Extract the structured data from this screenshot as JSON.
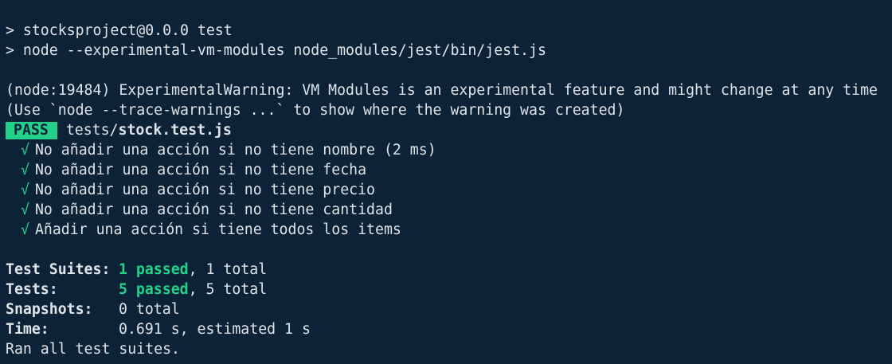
{
  "terminal": {
    "colors": {
      "background": "#0c2236",
      "foreground": "#dfe4e9",
      "pass": "#23d18b"
    },
    "header": {
      "line1": "> stocksproject@0.0.0 test",
      "line2": "> node --experimental-vm-modules node_modules/jest/bin/jest.js"
    },
    "warning": {
      "line1": "(node:19484) ExperimentalWarning: VM Modules is an experimental feature and might change at any time",
      "line2": "(Use `node --trace-warnings ...` to show where the warning was created)"
    },
    "result": {
      "badge": "PASS",
      "dir": "tests/",
      "file": "stock.test.js"
    },
    "tests": [
      {
        "check": "√",
        "text": "No añadir una acción si no tiene nombre (2 ms)"
      },
      {
        "check": "√",
        "text": "No añadir una acción si no tiene fecha"
      },
      {
        "check": "√",
        "text": "No añadir una acción si no tiene precio"
      },
      {
        "check": "√",
        "text": "No añadir una acción si no tiene cantidad"
      },
      {
        "check": "√",
        "text": "Añadir una acción si tiene todos los items"
      }
    ],
    "summary": {
      "suites": {
        "label": "Test Suites:",
        "passed": "1 passed",
        "rest": ", 1 total"
      },
      "tests": {
        "label": "Tests:",
        "passed": "5 passed",
        "rest": ", 5 total"
      },
      "snapshots": {
        "label": "Snapshots:",
        "value": "0 total"
      },
      "time": {
        "label": "Time:",
        "value": "0.691 s, estimated 1 s"
      },
      "footer": "Ran all test suites."
    }
  }
}
